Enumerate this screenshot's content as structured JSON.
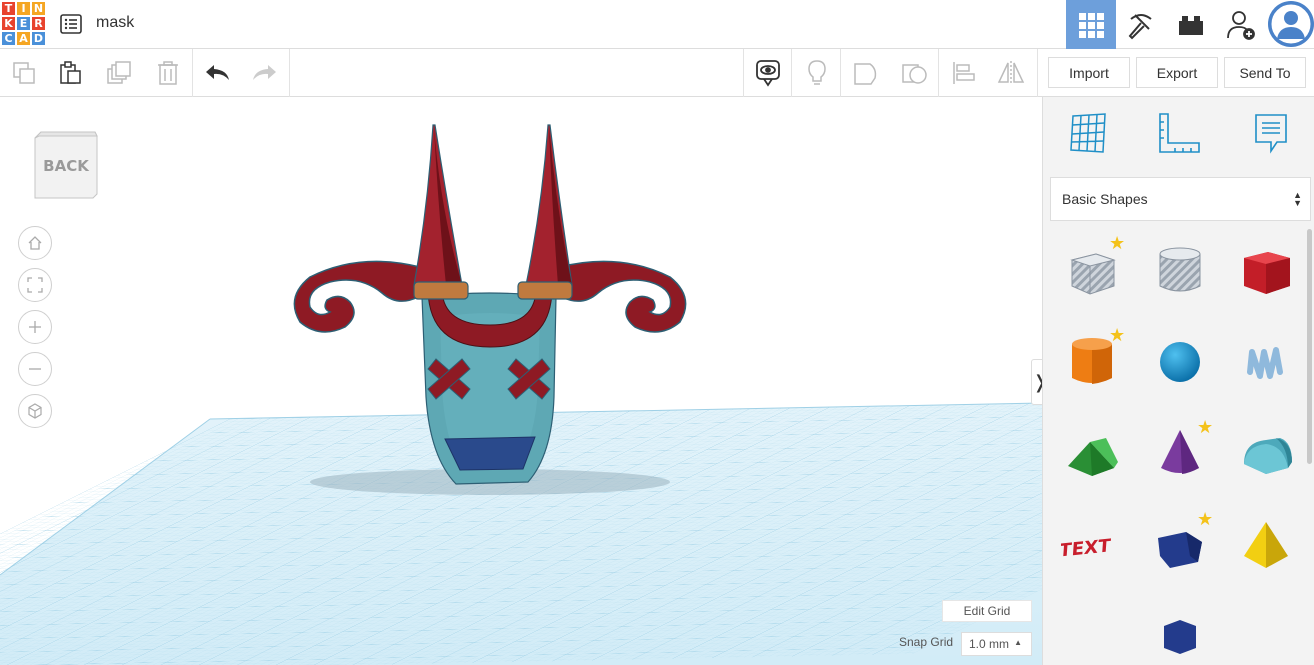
{
  "app": {
    "logo_letters": [
      "T",
      "I",
      "N",
      "K",
      "E",
      "R",
      "C",
      "A",
      "D"
    ],
    "logo_colors": [
      "#e8432e",
      "#f5a623",
      "#f5a623",
      "#e8432e",
      "#4a90d9",
      "#e8432e",
      "#4a90d9",
      "#f5a623",
      "#4a90d9"
    ],
    "design_title": "mask"
  },
  "toolbar": {
    "import_label": "Import",
    "export_label": "Export",
    "send_to_label": "Send To"
  },
  "viewport": {
    "viewcube_label": "BACK",
    "edit_grid_label": "Edit Grid",
    "snap_grid_label": "Snap Grid",
    "snap_grid_value": "1.0 mm"
  },
  "panel": {
    "shape_category": "Basic Shapes",
    "shapes": [
      {
        "name": "box-striped",
        "starred": true
      },
      {
        "name": "cylinder-striped",
        "starred": false
      },
      {
        "name": "box",
        "starred": false,
        "color": "#d8232a"
      },
      {
        "name": "cylinder",
        "starred": true,
        "color": "#ee7d13"
      },
      {
        "name": "sphere",
        "starred": false,
        "color": "#1b8fd0"
      },
      {
        "name": "scribble",
        "starred": false,
        "color": "#a3c8e6"
      },
      {
        "name": "roof",
        "starred": false,
        "color": "#2d9b3a"
      },
      {
        "name": "cone",
        "starred": true,
        "color": "#7a3b9e"
      },
      {
        "name": "round-roof",
        "starred": false,
        "color": "#5cb8c8"
      },
      {
        "name": "text",
        "starred": false,
        "color": "#c81e2c"
      },
      {
        "name": "polygon",
        "starred": true,
        "color": "#233b8c"
      },
      {
        "name": "pyramid",
        "starred": false,
        "color": "#f2cf12"
      }
    ]
  },
  "colors": {
    "accent": "#6d9fdb",
    "grid_line": "#a9d6ea",
    "mask_body": "#5ea8b4",
    "horn": "#8e1a24"
  }
}
